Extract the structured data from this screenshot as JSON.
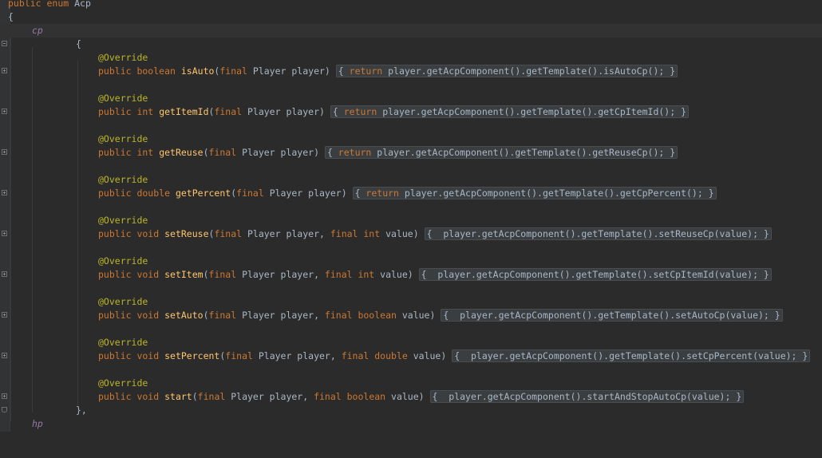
{
  "editor": {
    "theme_colors": {
      "background": "#2b2b2b",
      "keyword": "#cc7832",
      "annotation": "#bbb529",
      "method": "#ffc66d",
      "constant": "#9876aa",
      "text": "#a9b7c6"
    },
    "header": {
      "kw1": "public",
      "kw2": "enum",
      "name": "Acp"
    },
    "open_brace": "{",
    "constant_cp": "cp",
    "constant_hp": "hp",
    "inner_open": "{",
    "inner_close": "},",
    "annotation": "@Override",
    "methods": [
      {
        "sig_kw": "public boolean",
        "name": "isAuto",
        "params": [
          {
            "k": "final",
            "t": " Player player"
          }
        ],
        "body_kw": "return",
        "body": " player.getAcpComponent().getTemplate().isAutoCp();"
      },
      {
        "sig_kw": "public int",
        "name": "getItemId",
        "params": [
          {
            "k": "final",
            "t": " Player player"
          }
        ],
        "body_kw": "return",
        "body": " player.getAcpComponent().getTemplate().getCpItemId();"
      },
      {
        "sig_kw": "public int",
        "name": "getReuse",
        "params": [
          {
            "k": "final",
            "t": " Player player"
          }
        ],
        "body_kw": "return",
        "body": " player.getAcpComponent().getTemplate().getReuseCp();"
      },
      {
        "sig_kw": "public double",
        "name": "getPercent",
        "params": [
          {
            "k": "final",
            "t": " Player player"
          }
        ],
        "body_kw": "return",
        "body": " player.getAcpComponent().getTemplate().getCpPercent();"
      },
      {
        "sig_kw": "public void",
        "name": "setReuse",
        "params": [
          {
            "k": "final",
            "t": " Player player, "
          },
          {
            "k": "final int",
            "t": " value"
          }
        ],
        "body_kw": "",
        "body": " player.getAcpComponent().getTemplate().setReuseCp(value);"
      },
      {
        "sig_kw": "public void",
        "name": "setItem",
        "params": [
          {
            "k": "final",
            "t": " Player player, "
          },
          {
            "k": "final int",
            "t": " value"
          }
        ],
        "body_kw": "",
        "body": " player.getAcpComponent().getTemplate().setCpItemId(value);"
      },
      {
        "sig_kw": "public void",
        "name": "setAuto",
        "params": [
          {
            "k": "final",
            "t": " Player player, "
          },
          {
            "k": "final boolean",
            "t": " value"
          }
        ],
        "body_kw": "",
        "body": " player.getAcpComponent().getTemplate().setAutoCp(value);"
      },
      {
        "sig_kw": "public void",
        "name": "setPercent",
        "params": [
          {
            "k": "final",
            "t": " Player player, "
          },
          {
            "k": "final double",
            "t": " value"
          }
        ],
        "body_kw": "",
        "body": " player.getAcpComponent().getTemplate().setCpPercent(value);"
      },
      {
        "sig_kw": "public void",
        "name": "start",
        "params": [
          {
            "k": "final",
            "t": " Player player, "
          },
          {
            "k": "final boolean",
            "t": " value"
          }
        ],
        "body_kw": "",
        "body": " player.getAcpComponent().startAndStopAutoCp(value);"
      }
    ]
  }
}
